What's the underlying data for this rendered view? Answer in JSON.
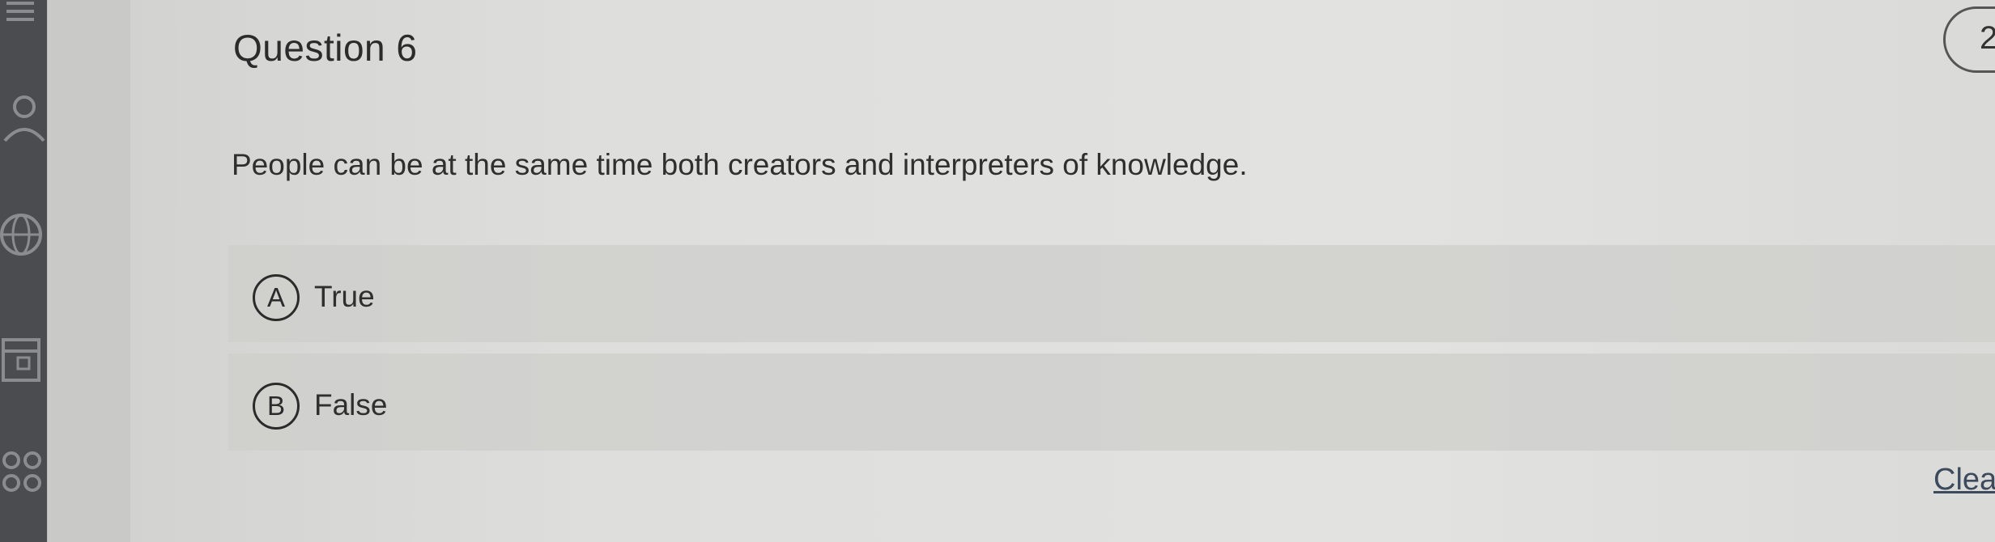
{
  "question": {
    "title": "Question 6",
    "points_badge": "2",
    "text": "People can be at the same time both creators and interpreters of knowledge."
  },
  "options": [
    {
      "letter": "A",
      "label": "True"
    },
    {
      "letter": "B",
      "label": "False"
    }
  ],
  "actions": {
    "clear_label": "Clea"
  },
  "sidebar": {
    "icons": [
      "user-icon",
      "globe-icon",
      "calendar-icon",
      "group-icon"
    ]
  }
}
